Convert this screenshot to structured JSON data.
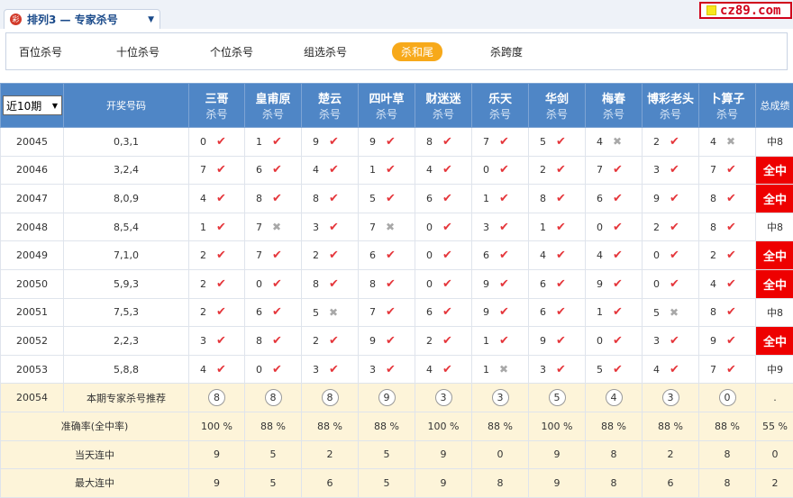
{
  "header": {
    "icon": "lottery-icon",
    "title": "排列3 — 专家杀号",
    "logo": "cz89.com"
  },
  "tabs": [
    "百位杀号",
    "十位杀号",
    "个位杀号",
    "组选杀号",
    "杀和尾",
    "杀跨度"
  ],
  "active_tab": "杀和尾",
  "period_select": "近10期",
  "columns": {
    "draw": "开奖号码",
    "total": "总成绩",
    "sub": "杀号"
  },
  "experts": [
    "三哥",
    "皇甫原",
    "楚云",
    "四叶草",
    "财迷迷",
    "乐天",
    "华剑",
    "梅春",
    "博彩老头",
    "卜算子"
  ],
  "rows": [
    {
      "period": "20045",
      "draw": "0,3,1",
      "picks": [
        "0",
        "1",
        "9",
        "9",
        "8",
        "7",
        "5",
        "4",
        "2",
        "4"
      ],
      "hits": [
        1,
        1,
        1,
        1,
        1,
        1,
        1,
        0,
        1,
        0
      ],
      "total": "中8",
      "full": false
    },
    {
      "period": "20046",
      "draw": "3,2,4",
      "picks": [
        "7",
        "6",
        "4",
        "1",
        "4",
        "0",
        "2",
        "7",
        "3",
        "7"
      ],
      "hits": [
        1,
        1,
        1,
        1,
        1,
        1,
        1,
        1,
        1,
        1
      ],
      "total": "全中",
      "full": true
    },
    {
      "period": "20047",
      "draw": "8,0,9",
      "picks": [
        "4",
        "8",
        "8",
        "5",
        "6",
        "1",
        "8",
        "6",
        "9",
        "8"
      ],
      "hits": [
        1,
        1,
        1,
        1,
        1,
        1,
        1,
        1,
        1,
        1
      ],
      "total": "全中",
      "full": true
    },
    {
      "period": "20048",
      "draw": "8,5,4",
      "picks": [
        "1",
        "7",
        "3",
        "7",
        "0",
        "3",
        "1",
        "0",
        "2",
        "8"
      ],
      "hits": [
        1,
        0,
        1,
        0,
        1,
        1,
        1,
        1,
        1,
        1
      ],
      "total": "中8",
      "full": false
    },
    {
      "period": "20049",
      "draw": "7,1,0",
      "picks": [
        "2",
        "7",
        "2",
        "6",
        "0",
        "6",
        "4",
        "4",
        "0",
        "2"
      ],
      "hits": [
        1,
        1,
        1,
        1,
        1,
        1,
        1,
        1,
        1,
        1
      ],
      "total": "全中",
      "full": true
    },
    {
      "period": "20050",
      "draw": "5,9,3",
      "picks": [
        "2",
        "0",
        "8",
        "8",
        "0",
        "9",
        "6",
        "9",
        "0",
        "4"
      ],
      "hits": [
        1,
        1,
        1,
        1,
        1,
        1,
        1,
        1,
        1,
        1
      ],
      "total": "全中",
      "full": true
    },
    {
      "period": "20051",
      "draw": "7,5,3",
      "picks": [
        "2",
        "6",
        "5",
        "7",
        "6",
        "9",
        "6",
        "1",
        "5",
        "8"
      ],
      "hits": [
        1,
        1,
        0,
        1,
        1,
        1,
        1,
        1,
        0,
        1
      ],
      "total": "中8",
      "full": false
    },
    {
      "period": "20052",
      "draw": "2,2,3",
      "picks": [
        "3",
        "8",
        "2",
        "9",
        "2",
        "1",
        "9",
        "0",
        "3",
        "9"
      ],
      "hits": [
        1,
        1,
        1,
        1,
        1,
        1,
        1,
        1,
        1,
        1
      ],
      "total": "全中",
      "full": true
    },
    {
      "period": "20053",
      "draw": "5,8,8",
      "picks": [
        "4",
        "0",
        "3",
        "3",
        "4",
        "1",
        "3",
        "5",
        "4",
        "7"
      ],
      "hits": [
        1,
        1,
        1,
        1,
        1,
        0,
        1,
        1,
        1,
        1
      ],
      "total": "中9",
      "full": false
    }
  ],
  "recommend": {
    "period": "20054",
    "label": "本期专家杀号推荐",
    "picks": [
      "8",
      "8",
      "8",
      "9",
      "3",
      "3",
      "5",
      "4",
      "3",
      "0"
    ],
    "total": "."
  },
  "accuracy": {
    "label": "准确率(全中率)",
    "values": [
      "100 %",
      "88 %",
      "88 %",
      "88 %",
      "100 %",
      "88 %",
      "100 %",
      "88 %",
      "88 %",
      "88 %"
    ],
    "total": "55 %"
  },
  "today_streak": {
    "label": "当天连中",
    "values": [
      "9",
      "5",
      "2",
      "5",
      "9",
      "0",
      "9",
      "8",
      "2",
      "8"
    ],
    "total": "0"
  },
  "max_streak": {
    "label": "最大连中",
    "values": [
      "9",
      "5",
      "6",
      "5",
      "9",
      "8",
      "9",
      "8",
      "6",
      "8"
    ],
    "total": "2"
  },
  "colors": {
    "header_bg": "#4f86c6",
    "hit": "#e5363b",
    "full_hit": "#ee0000",
    "active_tab": "#f7a91a",
    "footer_bg": "#fdf4d9"
  }
}
